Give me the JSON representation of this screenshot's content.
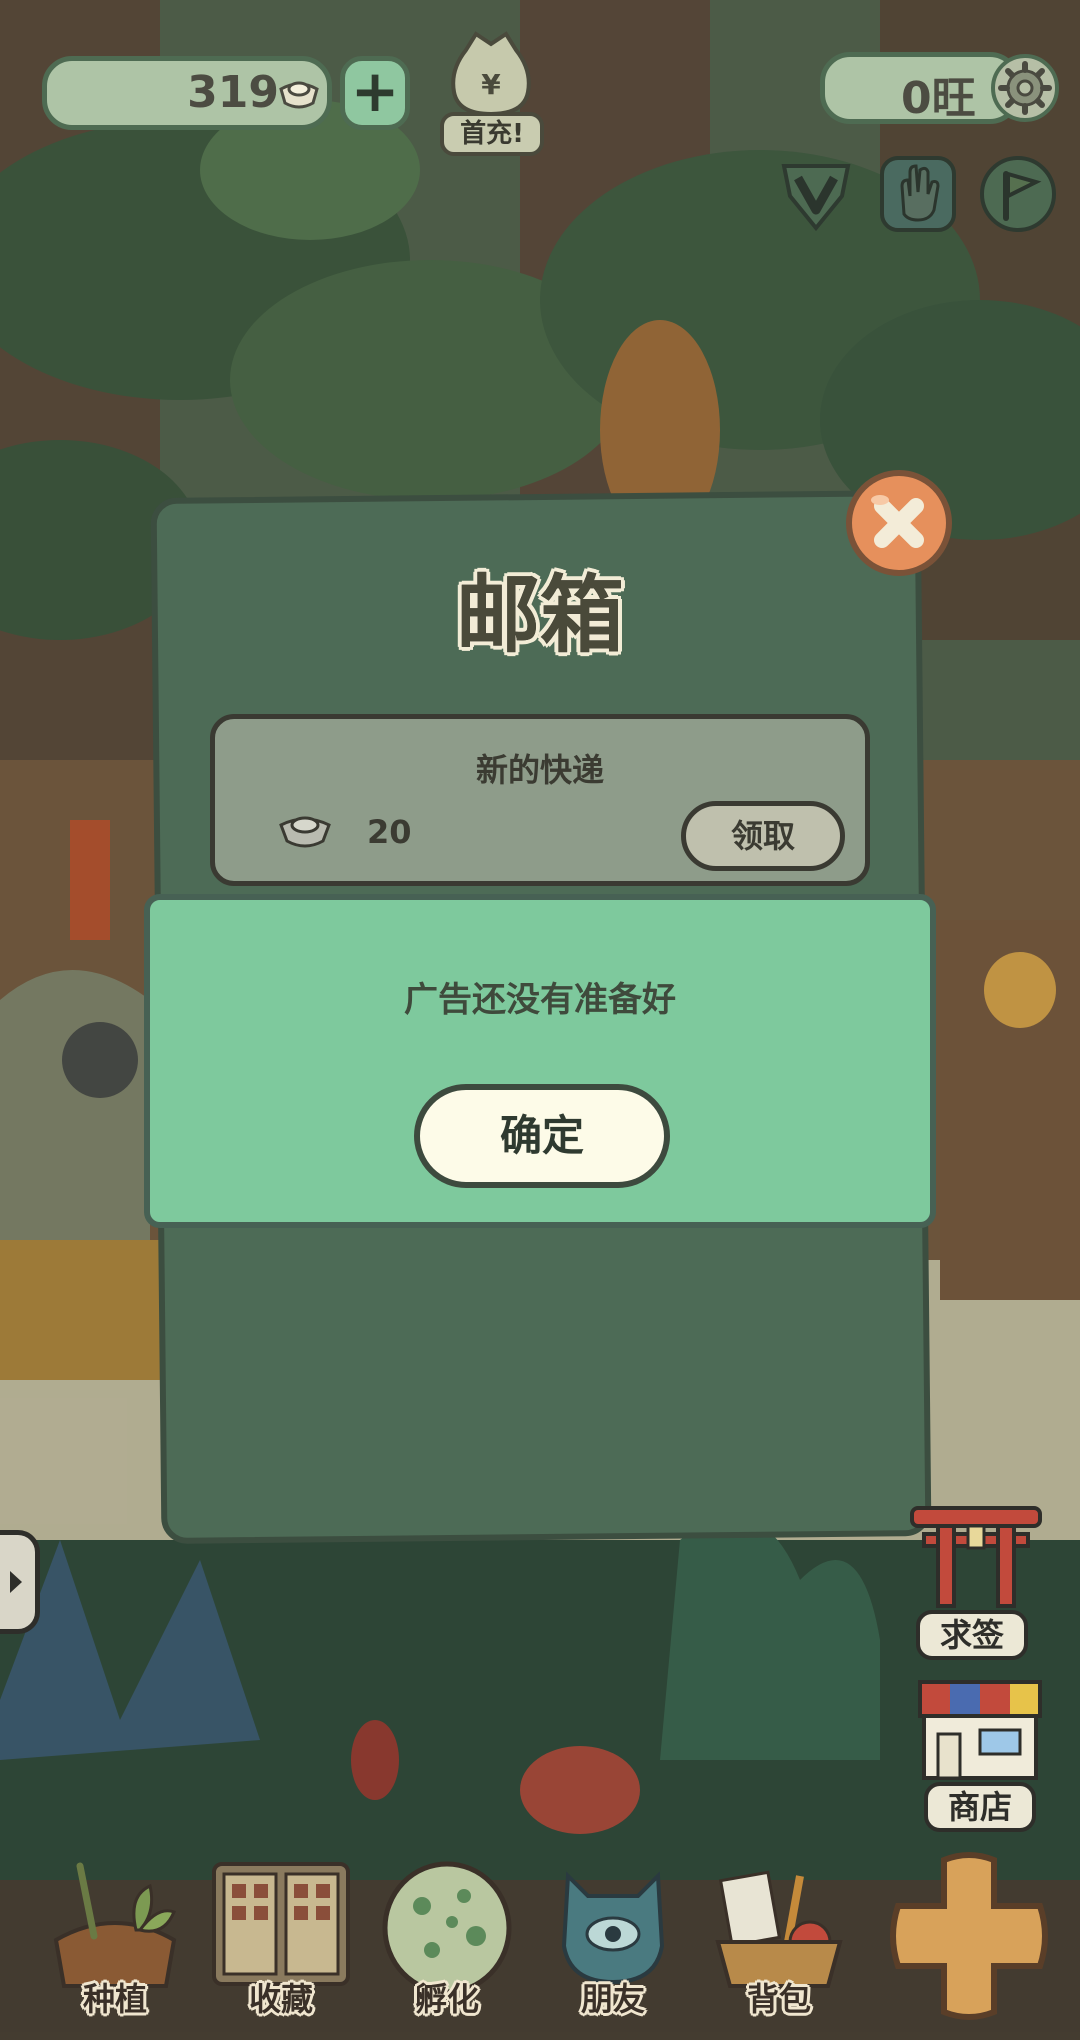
{
  "hud": {
    "ingot_count": "319",
    "add_label": "+",
    "first_charge_label": "首充!",
    "wang_count": "0旺"
  },
  "mailbox": {
    "title": "邮箱",
    "mail": {
      "subject": "新的快递",
      "amount": "20",
      "claim_label": "领取"
    }
  },
  "alert": {
    "message": "广告还没有准备好",
    "confirm_label": "确定"
  },
  "side": {
    "shrine_label": "求签",
    "shop_label": "商店"
  },
  "nav": {
    "plant": "种植",
    "collect": "收藏",
    "hatch": "孵化",
    "friends": "朋友",
    "bag": "背包"
  },
  "colors": {
    "panel": "#4d6b56",
    "alert_bg": "#7ec99d",
    "close_button": "#e6905c",
    "ok_button": "#fdfbe8"
  }
}
